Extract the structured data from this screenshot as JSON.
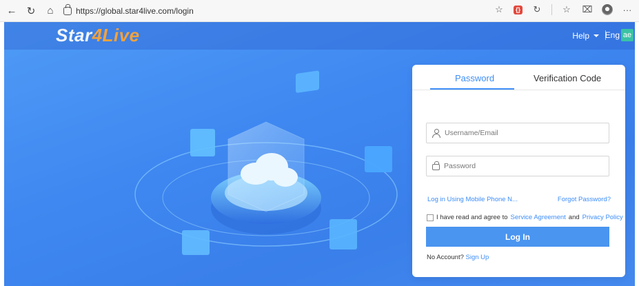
{
  "browser": {
    "url": "https://global.star4live.com/login"
  },
  "header": {
    "logo_prefix": "Star",
    "logo_accent": "4Live",
    "help_label": "Help",
    "language_label": "Eng",
    "language_badge": "ae"
  },
  "login": {
    "tab_password": "Password",
    "tab_verification": "Verification Code",
    "username_placeholder": "Username/Email",
    "password_placeholder": "Password",
    "mobile_login_link": "Log in Using Mobile Phone N...",
    "forgot_password_link": "Forgot Password?",
    "agree_text": "I have read and agree to",
    "service_agreement_link": "Service Agreement",
    "and_text": "and",
    "privacy_policy_link": "Privacy Policy",
    "login_button": "Log In",
    "no_account_text": "No Account?",
    "sign_up_link": "Sign Up"
  },
  "colors": {
    "accent_blue": "#3e8ef7",
    "hero_blue": "#4289ef",
    "logo_orange": "#f4a23b"
  },
  "icons": [
    "back-icon",
    "refresh-icon",
    "home-icon",
    "lock-icon",
    "star-icon",
    "extension-icon",
    "collections-icon",
    "favorites-icon",
    "screenshot-icon",
    "profile-icon",
    "more-icon",
    "user-icon",
    "password-icon"
  ]
}
